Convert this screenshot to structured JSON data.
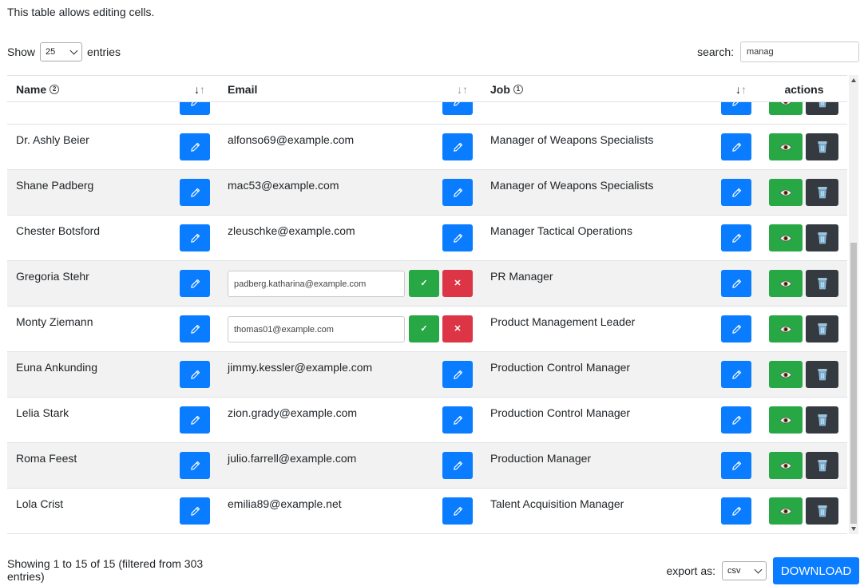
{
  "intro_text": "This table allows editing cells.",
  "length": {
    "show_label": "Show",
    "value": "25",
    "entries_label": "entries"
  },
  "search": {
    "label": "search:",
    "value": "manag"
  },
  "columns": {
    "name": {
      "label": "Name",
      "sort_order": "2"
    },
    "email": {
      "label": "Email"
    },
    "job": {
      "label": "Job",
      "sort_order": "1"
    },
    "actions": {
      "label": "actions"
    }
  },
  "sort_glyphs": {
    "desc": "↓",
    "asc": "↑"
  },
  "icons": {
    "edit": "pencil-icon",
    "view": "eye-icon",
    "delete": "trash-icon",
    "confirm": "check-icon",
    "cancel": "x-icon"
  },
  "icon_glyphs": {
    "check": "✓",
    "x": "✕"
  },
  "colors": {
    "primary": "#0a7cff",
    "success": "#28a745",
    "danger": "#dc3545",
    "dark": "#343a40",
    "stripe": "#f2f2f2"
  },
  "rows": [
    {
      "name": "Dr. Ashly Beier",
      "email": "alfonso69@example.com",
      "job": "Manager of Weapons Specialists",
      "editing_email": false
    },
    {
      "name": "Shane Padberg",
      "email": "mac53@example.com",
      "job": "Manager of Weapons Specialists",
      "editing_email": false
    },
    {
      "name": "Chester Botsford",
      "email": "zleuschke@example.com",
      "job": "Manager Tactical Operations",
      "editing_email": false
    },
    {
      "name": "Gregoria Stehr",
      "email": "padberg.katharina@example.com",
      "job": "PR Manager",
      "editing_email": true
    },
    {
      "name": "Monty Ziemann",
      "email": "thomas01@example.com",
      "job": "Product Management Leader",
      "editing_email": true
    },
    {
      "name": "Euna Ankunding",
      "email": "jimmy.kessler@example.com",
      "job": "Production Control Manager",
      "editing_email": false
    },
    {
      "name": "Lelia Stark",
      "email": "zion.grady@example.com",
      "job": "Production Control Manager",
      "editing_email": false
    },
    {
      "name": "Roma Feest",
      "email": "julio.farrell@example.com",
      "job": "Production Manager",
      "editing_email": false
    },
    {
      "name": "Lola Crist",
      "email": "emilia89@example.net",
      "job": "Talent Acquisition Manager",
      "editing_email": false
    }
  ],
  "info_text": "Showing 1 to 15 of 15 (filtered from 303 entries)",
  "export": {
    "label": "export as:",
    "format": "csv",
    "download_label": "DOWNLOAD"
  }
}
